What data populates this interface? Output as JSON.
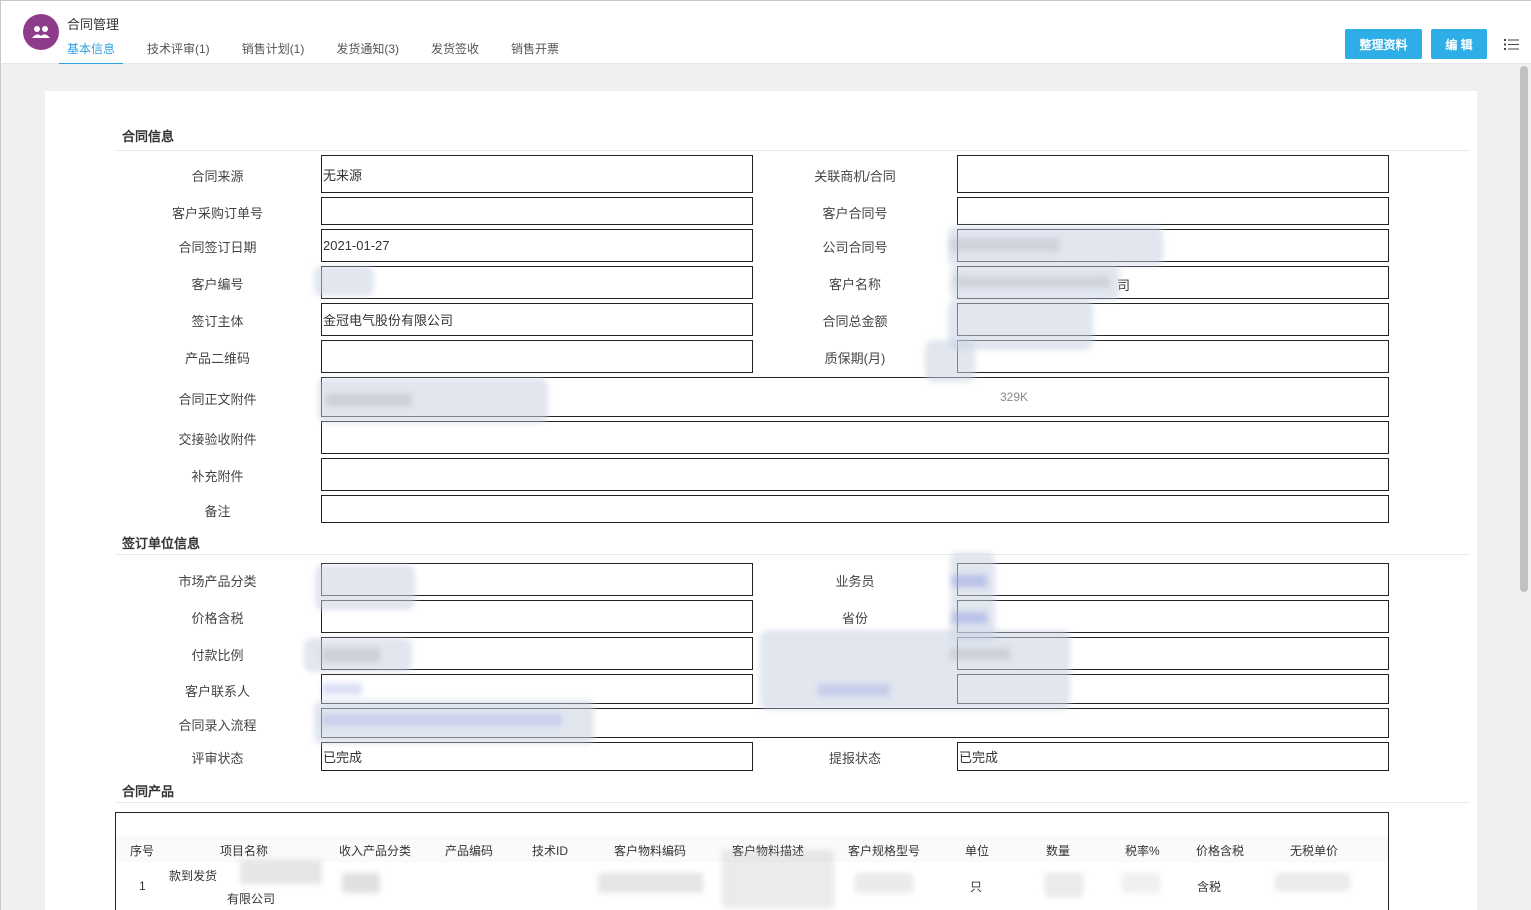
{
  "app": {
    "title": "合同管理"
  },
  "tabs": [
    "基本信息",
    "技术评审(1)",
    "销售计划(1)",
    "发货通知(3)",
    "发货签收",
    "销售开票"
  ],
  "buttons": {
    "organize": "整理资料",
    "edit": "编 辑"
  },
  "sections": {
    "contract_info": "合同信息",
    "sign_unit": "签订单位信息",
    "products": "合同产品"
  },
  "contract_info": {
    "source_label": "合同来源",
    "source_value": "无来源",
    "related_label": "关联商机/合同",
    "related_value": "",
    "po_label": "客户采购订单号",
    "po_value": "",
    "cust_contract_label": "客户合同号",
    "cust_contract_value": "",
    "sign_date_label": "合同签订日期",
    "sign_date_value": "2021-01-27",
    "company_contract_label": "公司合同号",
    "cust_code_label": "客户编号",
    "cust_name_label": "客户名称",
    "cust_name_tail": "司",
    "subject_label": "签订主体",
    "subject_value": "金冠电气股份有限公司",
    "total_label": "合同总金额",
    "qrcode_label": "产品二维码",
    "qrcode_value": "",
    "warranty_label": "质保期(月)",
    "attachment_label": "合同正文附件",
    "attachment_size": "329K",
    "handover_label": "交接验收附件",
    "handover_value": "",
    "extra_label": "补充附件",
    "extra_value": "",
    "remark_label": "备注",
    "remark_value": ""
  },
  "sign_unit": {
    "market_label": "市场产品分类",
    "salesman_label": "业务员",
    "tax_label": "价格含税",
    "province_label": "省份",
    "pay_label": "付款比例",
    "contact_label": "客户联系人",
    "flow_label": "合同录入流程",
    "review_label": "评审状态",
    "review_value": "已完成",
    "report_label": "提报状态",
    "report_value": "已完成"
  },
  "product_table": {
    "headers": [
      "序号",
      "项目名称",
      "收入产品分类",
      "产品编码",
      "技术ID",
      "客户物料编码",
      "客户物料描述",
      "客户规格型号",
      "单位",
      "数量",
      "税率%",
      "价格含税",
      "无税单价"
    ],
    "row": {
      "index": "1",
      "project_line1": "款到发货",
      "project_line2": "有限公司",
      "unit": "只",
      "tax_included": "含税"
    }
  }
}
